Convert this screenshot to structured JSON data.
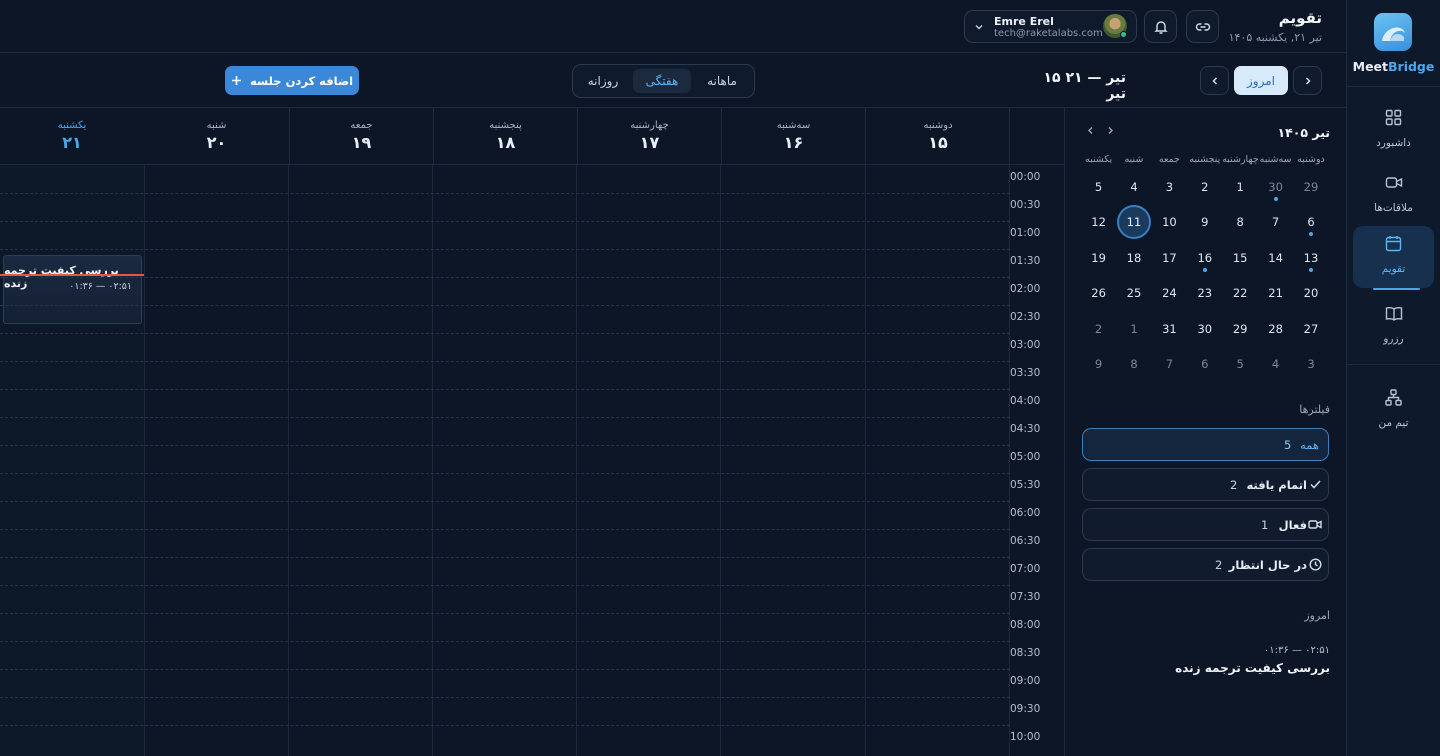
{
  "brand": {
    "name_a": "Meet",
    "name_b": "Bridge"
  },
  "nav": {
    "items": [
      {
        "label": "داشبورد"
      },
      {
        "label": "ملاقات‌ها"
      },
      {
        "label": "تقویم"
      },
      {
        "label": "رزرو"
      },
      {
        "label": "تیم من"
      }
    ]
  },
  "header": {
    "title": "تقویم",
    "date": "۱۴۰۵ تیر ۲۱, یکشنبه",
    "user": {
      "name": "Emre Erel",
      "email": "tech@raketalabs.com"
    }
  },
  "toolbar": {
    "today": "امروز",
    "range": "۱۵ تیر — ۲۱ تیر",
    "views": [
      "ماهانه",
      "هفتگی",
      "روزانه"
    ],
    "active_view": "هفتگی",
    "add_session": "اضافه کردن جلسه"
  },
  "week": {
    "days": [
      {
        "name": "دوشنبه",
        "date": "۱۵"
      },
      {
        "name": "سه‌شنبه",
        "date": "۱۶"
      },
      {
        "name": "چهارشنبه",
        "date": "۱۷"
      },
      {
        "name": "پنجشنبه",
        "date": "۱۸"
      },
      {
        "name": "جمعه",
        "date": "۱۹"
      },
      {
        "name": "شنبه",
        "date": "۲۰"
      },
      {
        "name": "یکشنبه",
        "date": "۲۱"
      }
    ],
    "times": [
      "00:00",
      "00:30",
      "01:00",
      "01:30",
      "02:00",
      "02:30",
      "03:00",
      "03:30",
      "04:00",
      "04:30",
      "05:00",
      "05:30",
      "06:00",
      "06:30",
      "07:00",
      "07:30",
      "08:00",
      "08:30",
      "09:00",
      "09:30",
      "10:00"
    ],
    "event": {
      "title": "بررسی کیفیت ترجمه زنده",
      "time": "۰۱:۳۶ — ۰۲:۵۱"
    }
  },
  "mini_calendar": {
    "title": "۱۴۰۵ تیر",
    "weekdays": [
      "دوشنبه",
      "سه‌شنبه",
      "چهارشنبه",
      "پنجشنبه",
      "جمعه",
      "شنبه",
      "یکشنبه"
    ],
    "rows": [
      [
        "29",
        "30",
        "1",
        "2",
        "3",
        "4",
        "5"
      ],
      [
        "6",
        "7",
        "8",
        "9",
        "10",
        "11",
        "12"
      ],
      [
        "13",
        "14",
        "15",
        "16",
        "17",
        "18",
        "19"
      ],
      [
        "20",
        "21",
        "22",
        "23",
        "24",
        "25",
        "26"
      ],
      [
        "27",
        "28",
        "29",
        "30",
        "31",
        "1",
        "2"
      ],
      [
        "3",
        "4",
        "5",
        "6",
        "7",
        "8",
        "9"
      ]
    ]
  },
  "filters": {
    "title": "فیلترها",
    "items": [
      {
        "label": "همه",
        "count": "5"
      },
      {
        "label": "اتمام یافته",
        "count": "2"
      },
      {
        "label": "فعال",
        "count": "1"
      },
      {
        "label": "در حال انتظار",
        "count": "2"
      }
    ]
  },
  "today_section": {
    "title": "امروز",
    "event_time": "۰۱:۳۶ — ۰۲:۵۱",
    "event_title": "بررسی کیفیت ترجمه زنده"
  },
  "colors": {
    "accent": "#4aa7ee",
    "background": "#0c1626",
    "now_line": "#e4574e"
  }
}
